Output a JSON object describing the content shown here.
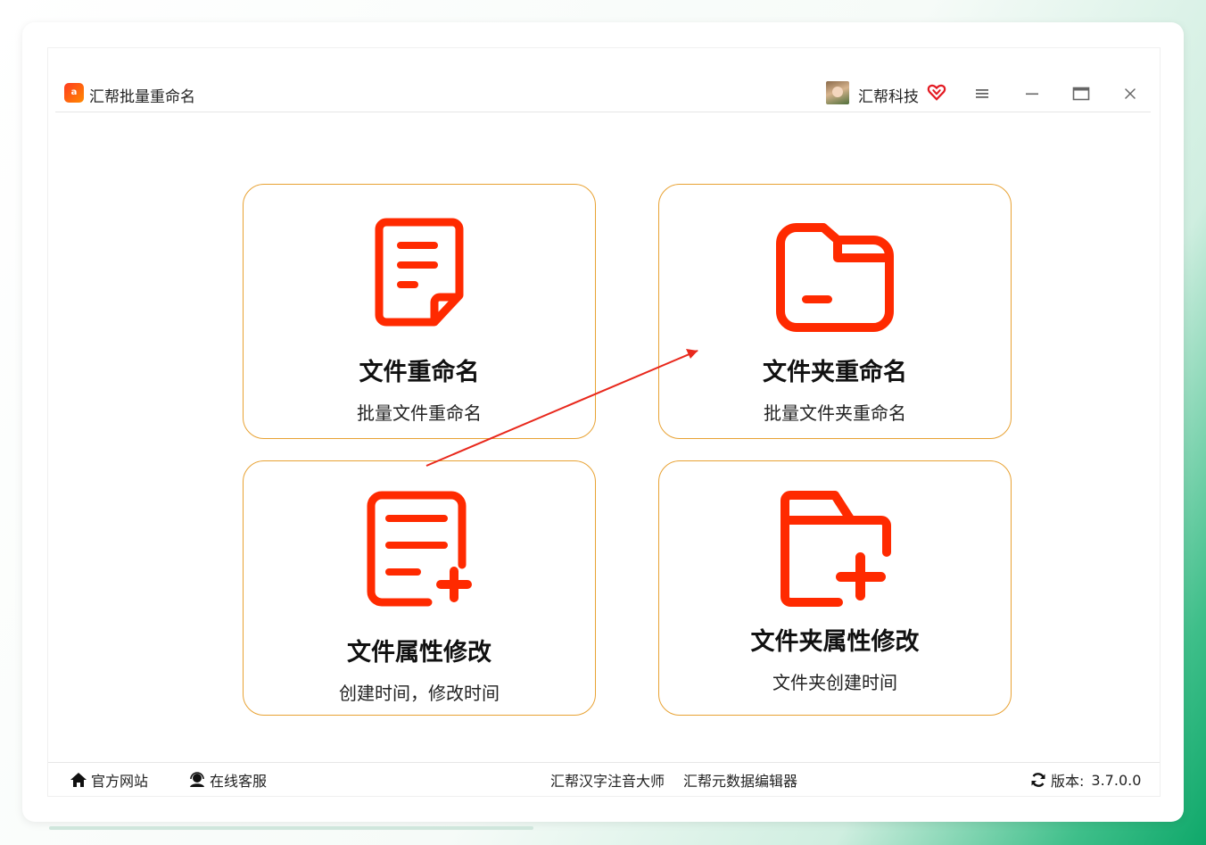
{
  "app": {
    "logo_text": "a",
    "title": "汇帮批量重命名"
  },
  "header": {
    "user_name": "汇帮科技",
    "icons": [
      "avatar",
      "vip-heart-icon",
      "menu-icon",
      "minimize-icon",
      "maximize-icon",
      "close-icon"
    ]
  },
  "cards": {
    "file_rename": {
      "title": "文件重命名",
      "subtitle": "批量文件重命名",
      "icon": "document-icon"
    },
    "folder_rename": {
      "title": "文件夹重命名",
      "subtitle": "批量文件夹重命名",
      "icon": "folder-icon"
    },
    "file_attr": {
      "title": "文件属性修改",
      "subtitle": "创建时间，修改时间",
      "icon": "document-add-icon"
    },
    "folder_attr": {
      "title": "文件夹属性修改",
      "subtitle": "文件夹创建时间",
      "icon": "folder-add-icon"
    }
  },
  "footer": {
    "site_label": "官方网站",
    "service_label": "在线客服",
    "pinyin_label": "汇帮汉字注音大师",
    "meta_label": "汇帮元数据编辑器",
    "version_label": "版本:",
    "version_value": "3.7.0.0"
  },
  "colors": {
    "accent_red": "#ff2a00",
    "card_border": "#e8a233",
    "annotation_arrow": "#e8281c"
  }
}
